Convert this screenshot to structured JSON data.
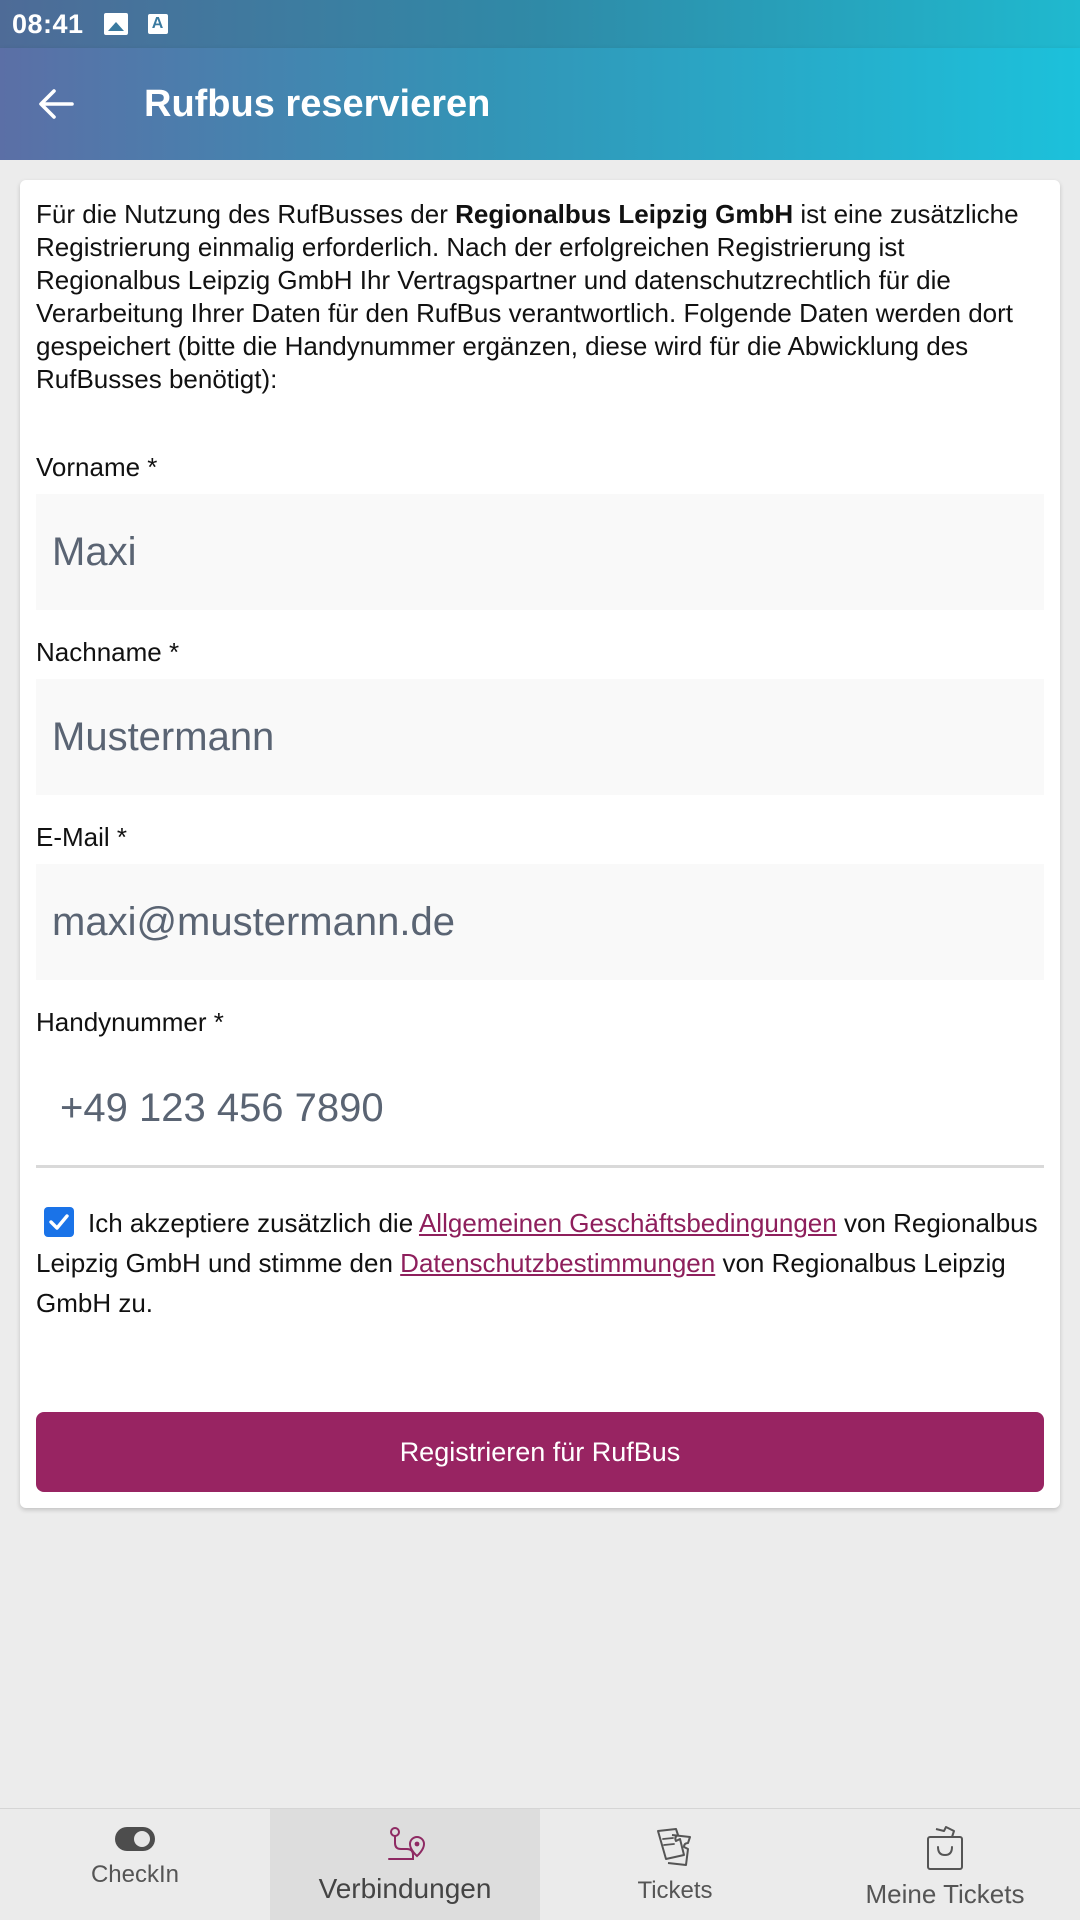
{
  "status_bar": {
    "time": "08:41",
    "icons": [
      "image-icon",
      "font-icon"
    ]
  },
  "app_bar": {
    "title": "Rufbus reservieren",
    "back_icon": "arrow-left-icon"
  },
  "intro": {
    "text_1": "Für die Nutzung des RufBusses der ",
    "company_bold": "Regionalbus Leipzig GmbH",
    "text_2": " ist eine zusätzliche Registrierung einmalig erforderlich. Nach der erfolgreichen Registrierung ist Regionalbus Leipzig GmbH Ihr Vertragspartner und datenschutzrechtlich für die Verarbeitung Ihrer Daten für den RufBus verantwortlich. Folgende Daten werden dort gespeichert (bitte die Handynummer ergänzen, diese wird für die Abwicklung des RufBusses benötigt):"
  },
  "form": {
    "first_name": {
      "label": "Vorname *",
      "value": "Maxi"
    },
    "last_name": {
      "label": "Nachname *",
      "value": "Mustermann"
    },
    "email": {
      "label": "E-Mail *",
      "value": "maxi@mustermann.de"
    },
    "phone": {
      "label": "Handynummer *",
      "value": "+49 123 456 7890"
    }
  },
  "consent": {
    "checked": true,
    "text_1": "Ich akzeptiere zusätzlich die ",
    "terms_link": "Allgemeinen Geschäftsbedingungen",
    "text_2": " von Regionalbus Leipzig GmbH und stimme den ",
    "privacy_link": "Datenschutzbestimmungen",
    "text_3": " von Regionalbus Leipzig GmbH zu."
  },
  "register_button": {
    "label": "Registrieren für RufBus"
  },
  "bottom_nav": {
    "items": [
      {
        "label": "CheckIn",
        "icon": "toggle-icon",
        "active": false
      },
      {
        "label": "Verbindungen",
        "icon": "route-pin-icon",
        "active": true
      },
      {
        "label": "Tickets",
        "icon": "tickets-icon",
        "active": false
      },
      {
        "label": "Meine Tickets",
        "icon": "shopping-bag-icon",
        "active": false
      }
    ]
  },
  "colors": {
    "accent": "#982462",
    "link": "#8e1f5c",
    "checkbox": "#1a73e8",
    "header_start": "#5b6fa6",
    "header_end": "#1cc1db"
  }
}
